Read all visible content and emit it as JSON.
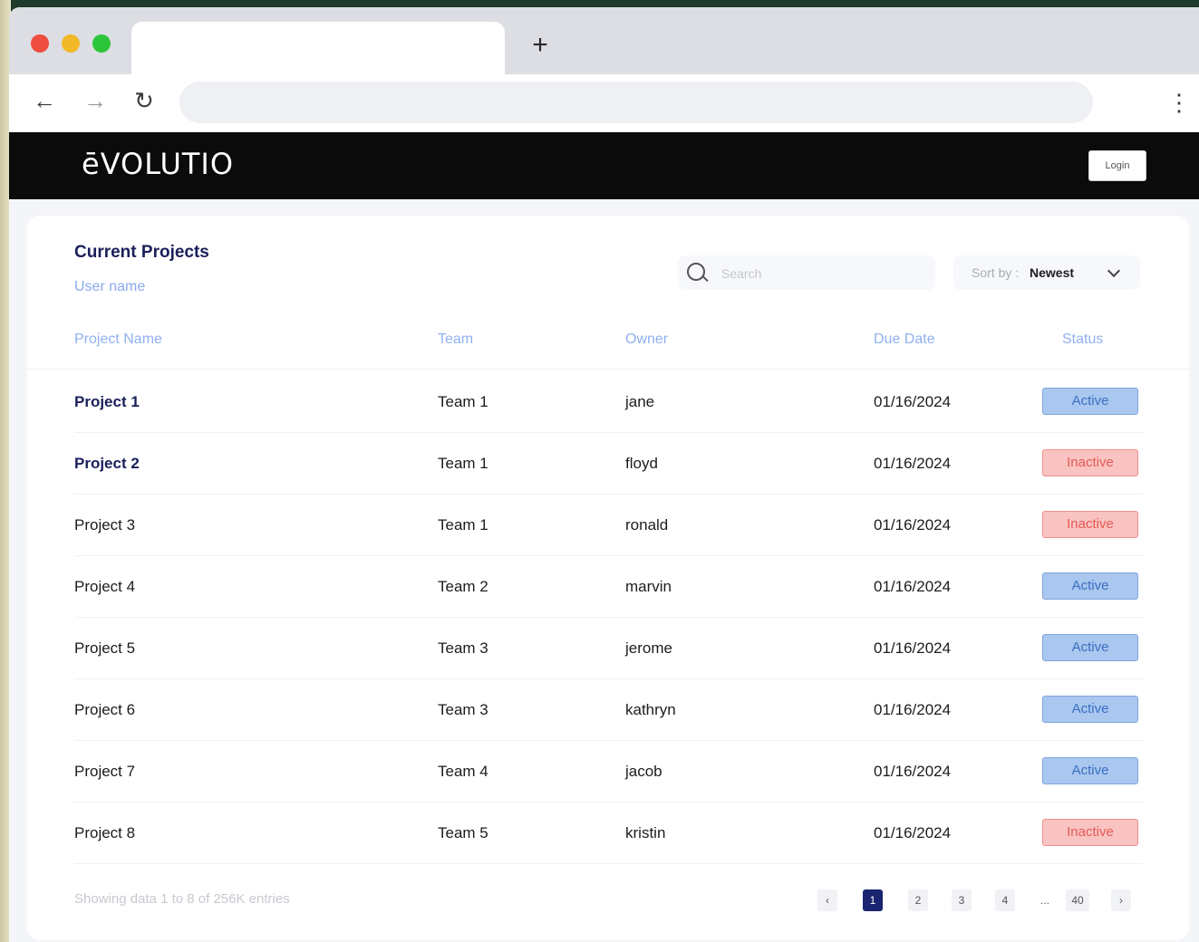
{
  "browser": {
    "new_tab_symbol": "+",
    "back_symbol": "←",
    "forward_symbol": "→",
    "reload_symbol": "↻",
    "menu_symbol": "⋮"
  },
  "app": {
    "logo": "ēVOLUTIO",
    "login_label": "Login"
  },
  "card": {
    "title": "Current Projects",
    "subtitle": "User name",
    "search_placeholder": "Search",
    "sort_label": "Sort by :",
    "sort_value": "Newest"
  },
  "table": {
    "headers": [
      "Project Name",
      "Team",
      "Owner",
      "Due Date",
      "Status"
    ],
    "rows": [
      {
        "project": "Project 1",
        "team": "Team 1",
        "owner": "jane",
        "due": "01/16/2024",
        "status": "Active"
      },
      {
        "project": "Project 2",
        "team": "Team 1",
        "owner": "floyd",
        "due": "01/16/2024",
        "status": "Inactive"
      },
      {
        "project": "Project 3",
        "team": "Team 1",
        "owner": "ronald",
        "due": "01/16/2024",
        "status": "Inactive"
      },
      {
        "project": "Project 4",
        "team": "Team 2",
        "owner": "marvin",
        "due": "01/16/2024",
        "status": "Active"
      },
      {
        "project": "Project 5",
        "team": "Team 3",
        "owner": "jerome",
        "due": "01/16/2024",
        "status": "Active"
      },
      {
        "project": "Project 6",
        "team": "Team 3",
        "owner": "kathryn",
        "due": "01/16/2024",
        "status": "Active"
      },
      {
        "project": "Project 7",
        "team": "Team 4",
        "owner": "jacob",
        "due": "01/16/2024",
        "status": "Active"
      },
      {
        "project": "Project 8",
        "team": "Team 5",
        "owner": "kristin",
        "due": "01/16/2024",
        "status": "Inactive"
      }
    ]
  },
  "footer": {
    "showing": "Showing data 1 to 8 of 256K entries",
    "pages": [
      "‹",
      "1",
      "2",
      "3",
      "4",
      "...",
      "40",
      "›"
    ],
    "current_page": "1"
  },
  "colors": {
    "header_bg": "#0b0b0c",
    "title": "#1a1f5a",
    "active_bg": "#a9c7ef",
    "inactive_bg": "#f9c3c1",
    "current_page_bg": "#1a2470"
  }
}
